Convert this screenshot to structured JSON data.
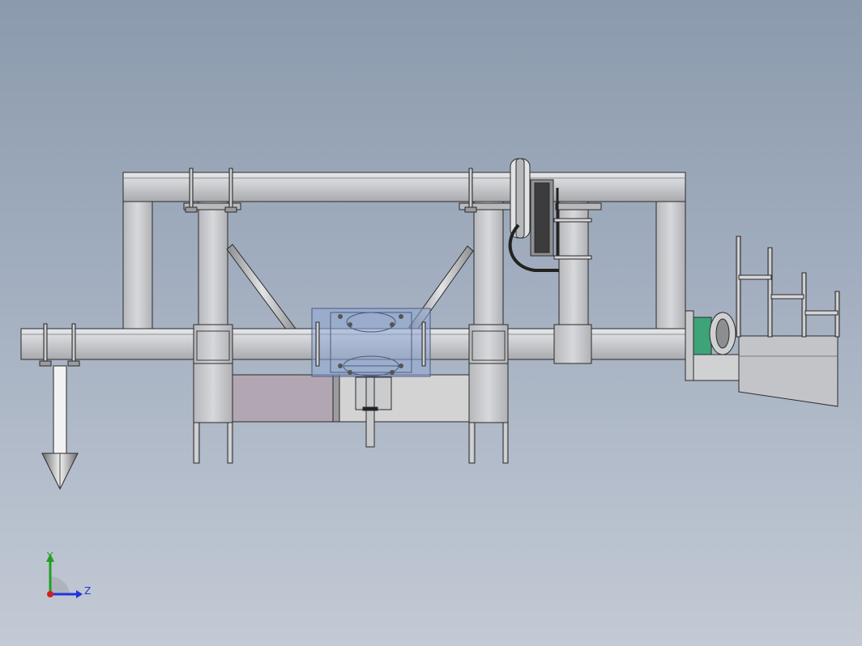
{
  "triad": {
    "y_label": "Y",
    "z_label": "Z",
    "colors": {
      "y": "#1fa01f",
      "z": "#2233dd",
      "x": "#d42020"
    }
  },
  "colors": {
    "background_top": "#8b9aad",
    "background_bottom": "#c3cad5",
    "steel": "#c8c9cc",
    "steel_edge": "#2a2a2a",
    "transparent_housing": "#8fa8d6",
    "motor": "#3fa37a",
    "pink_panel": "#b3a6b3"
  }
}
